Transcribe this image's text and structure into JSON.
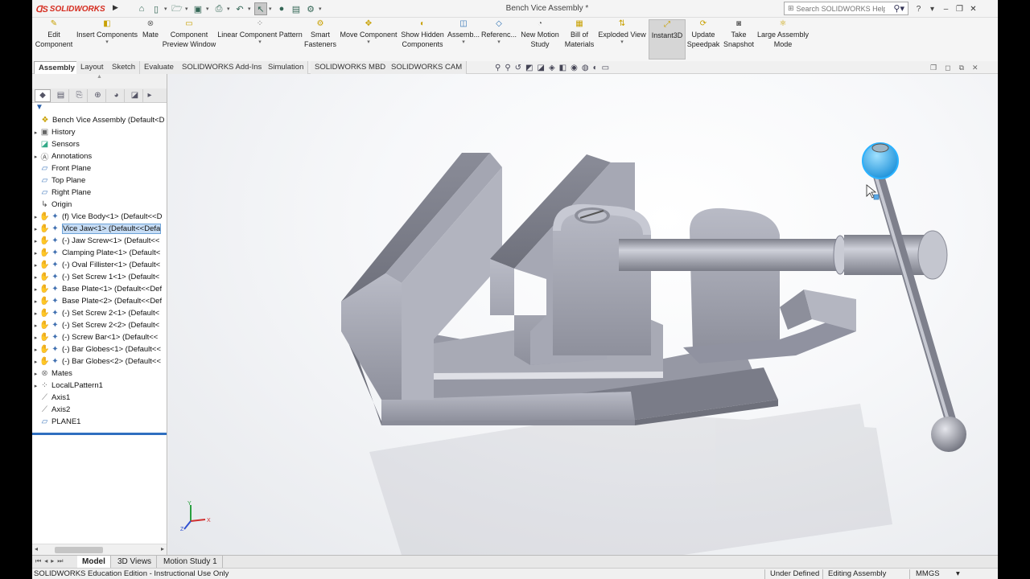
{
  "app": {
    "brand": "SOLIDWORKS",
    "document_title": "Bench Vice Assembly *"
  },
  "search": {
    "placeholder": "Search SOLIDWORKS Help"
  },
  "commands": [
    {
      "label": "Edit\nComponent",
      "icon": "edit-component-icon"
    },
    {
      "label": "Insert Components",
      "icon": "insert-components-icon"
    },
    {
      "label": "Mate",
      "icon": "mate-icon"
    },
    {
      "label": "Component\nPreview Window",
      "icon": "preview-window-icon"
    },
    {
      "label": "Linear Component Pattern",
      "icon": "linear-pattern-icon"
    },
    {
      "label": "Smart\nFasteners",
      "icon": "smart-fasteners-icon"
    },
    {
      "label": "Move Component",
      "icon": "move-component-icon"
    },
    {
      "label": "Show Hidden\nComponents",
      "icon": "show-hidden-icon"
    },
    {
      "label": "Assemb...",
      "icon": "assembly-features-icon"
    },
    {
      "label": "Referenc...",
      "icon": "reference-geometry-icon"
    },
    {
      "label": "New Motion\nStudy",
      "icon": "motion-study-icon"
    },
    {
      "label": "Bill of\nMaterials",
      "icon": "bom-icon"
    },
    {
      "label": "Exploded View",
      "icon": "exploded-view-icon"
    },
    {
      "label": "Instant3D",
      "icon": "instant3d-icon"
    },
    {
      "label": "Update\nSpeedpak",
      "icon": "speedpak-icon"
    },
    {
      "label": "Take\nSnapshot",
      "icon": "snapshot-icon"
    },
    {
      "label": "Large Assembly\nMode",
      "icon": "large-assembly-icon"
    }
  ],
  "ribbon_tabs": [
    "Assembly",
    "Layout",
    "Sketch",
    "Evaluate",
    "SOLIDWORKS Add-Ins",
    "Simulation",
    "SOLIDWORKS MBD",
    "SOLIDWORKS CAM"
  ],
  "tree": [
    {
      "label": "Bench Vice Assembly  (Default<D",
      "icon": "assembly-icon"
    },
    {
      "label": "History",
      "icon": "history-icon"
    },
    {
      "label": "Sensors",
      "icon": "sensors-icon"
    },
    {
      "label": "Annotations",
      "icon": "annotations-icon"
    },
    {
      "label": "Front Plane",
      "icon": "plane-icon"
    },
    {
      "label": "Top Plane",
      "icon": "plane-icon"
    },
    {
      "label": "Right Plane",
      "icon": "plane-icon"
    },
    {
      "label": "Origin",
      "icon": "origin-icon"
    },
    {
      "label": "(f) Vice Body<1> (Default<<D",
      "icon": "part-icon"
    },
    {
      "label": "Vice Jaw<1> (Default<<Defa",
      "icon": "part-icon"
    },
    {
      "label": "(-) Jaw Screw<1> (Default<<",
      "icon": "part-icon"
    },
    {
      "label": "Clamping Plate<1> (Default<",
      "icon": "part-icon"
    },
    {
      "label": "(-) Oval Fillister<1> (Default<",
      "icon": "part-icon"
    },
    {
      "label": "(-) Set Screw 1<1> (Default<",
      "icon": "part-icon"
    },
    {
      "label": "Base Plate<1> (Default<<Def",
      "icon": "part-icon"
    },
    {
      "label": "Base Plate<2> (Default<<Def",
      "icon": "part-icon"
    },
    {
      "label": "(-) Set Screw 2<1> (Default<",
      "icon": "part-icon"
    },
    {
      "label": "(-) Set Screw 2<2> (Default<",
      "icon": "part-icon"
    },
    {
      "label": "(-) Screw Bar<1> (Default<<",
      "icon": "part-icon"
    },
    {
      "label": "(-) Bar Globes<1> (Default<<",
      "icon": "part-icon"
    },
    {
      "label": "(-) Bar Globes<2> (Default<<",
      "icon": "part-icon"
    },
    {
      "label": "Mates",
      "icon": "mates-icon"
    },
    {
      "label": "LocalLPattern1",
      "icon": "pattern-icon"
    },
    {
      "label": "Axis1",
      "icon": "axis-icon"
    },
    {
      "label": "Axis2",
      "icon": "axis-icon"
    },
    {
      "label": "PLANE1",
      "icon": "plane-icon"
    }
  ],
  "bottom_tabs": [
    "Model",
    "3D Views",
    "Motion Study 1"
  ],
  "status": {
    "edition": "SOLIDWORKS Education Edition - Instructional Use Only",
    "definition": "Under Defined",
    "mode": "Editing Assembly",
    "units": "MMGS"
  },
  "colors": {
    "accent": "#2f6fc0",
    "selection": "#c7ddf5",
    "brand_red": "#d52b1e",
    "part_gray": "#9ea0ad",
    "highlight_cyan": "#29a9f0"
  }
}
